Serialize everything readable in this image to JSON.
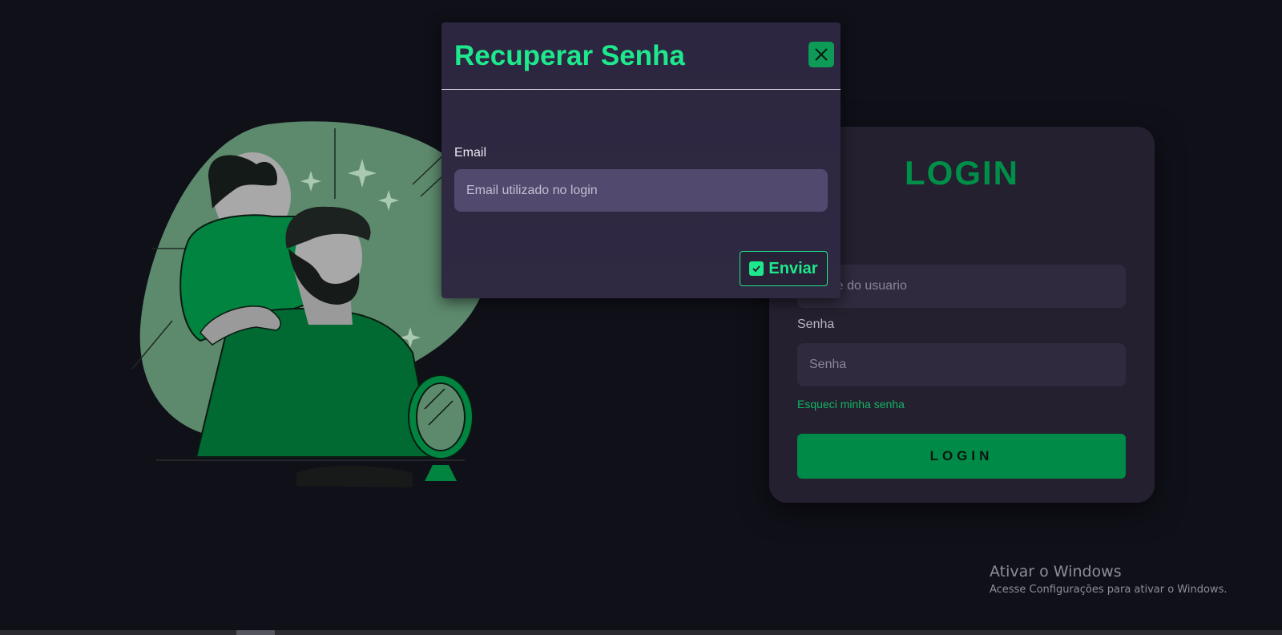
{
  "modal": {
    "title": "Recuperar Senha",
    "close_icon": "close-icon",
    "email_label": "Email",
    "email_placeholder": "Email utilizado no login",
    "email_value": "",
    "send_label": "Enviar",
    "send_icon": "check-square-icon"
  },
  "login": {
    "title": "LOGIN",
    "user_placeholder": "Nome do usuario",
    "password_label": "Senha",
    "password_placeholder": "Senha",
    "forgot_link": "Esqueci minha senha",
    "button_label": "LOGIN"
  },
  "watermark": {
    "title": "Ativar o Windows",
    "subtitle": "Acesse Configurações para ativar o Windows."
  },
  "colors": {
    "background": "#101019",
    "accent": "#1ee88c",
    "brand_green": "#008a47",
    "card": "#24202f",
    "modal": "#2c2640"
  }
}
